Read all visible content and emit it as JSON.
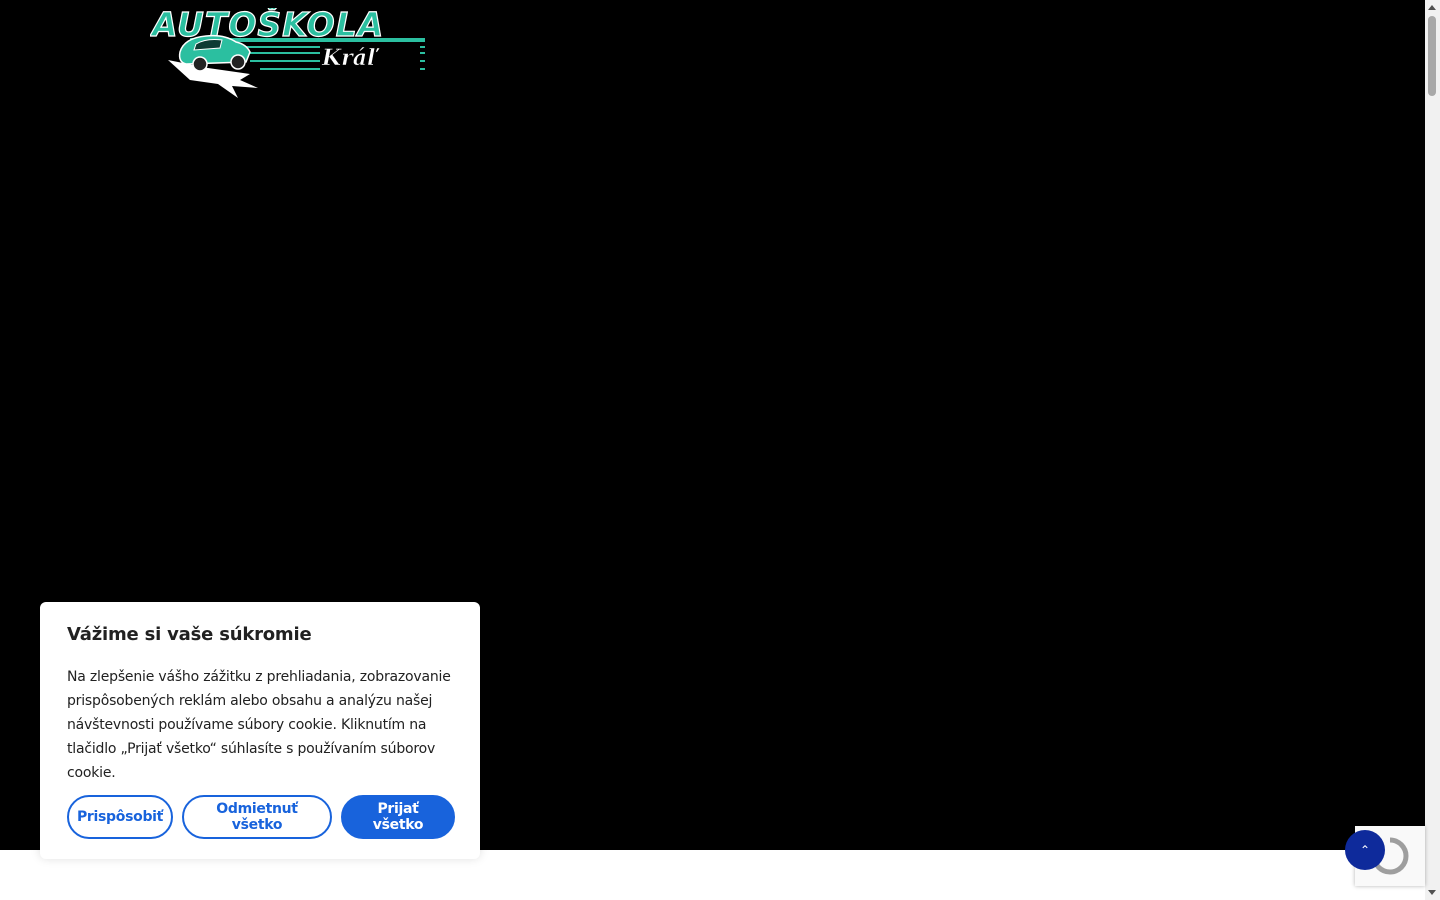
{
  "brand": {
    "logo_text": "AUTOŠKOLA",
    "logo_subtext": "Kráľ",
    "accent_color": "#2bbfa0"
  },
  "cookie_banner": {
    "title": "Vážime si vaše súkromie",
    "message": "Na zlepšenie vášho zážitku z prehliadania, zobrazovanie prispôsobených reklám alebo obsahu a analýzu našej návštevnosti používame súbory cookie. Kliknutím na tlačidlo „Prijať všetko“ súhlasíte s používaním súborov cookie.",
    "customize_label": "Prispôsobiť",
    "reject_label": "Odmietnuť všetko",
    "accept_label": "Prijať všetko",
    "accent_color": "#1863dc"
  },
  "back_to_top": {
    "icon": "chevron-up-icon",
    "glyph": "⌃"
  },
  "recaptcha": {
    "icon": "recaptcha-icon"
  }
}
